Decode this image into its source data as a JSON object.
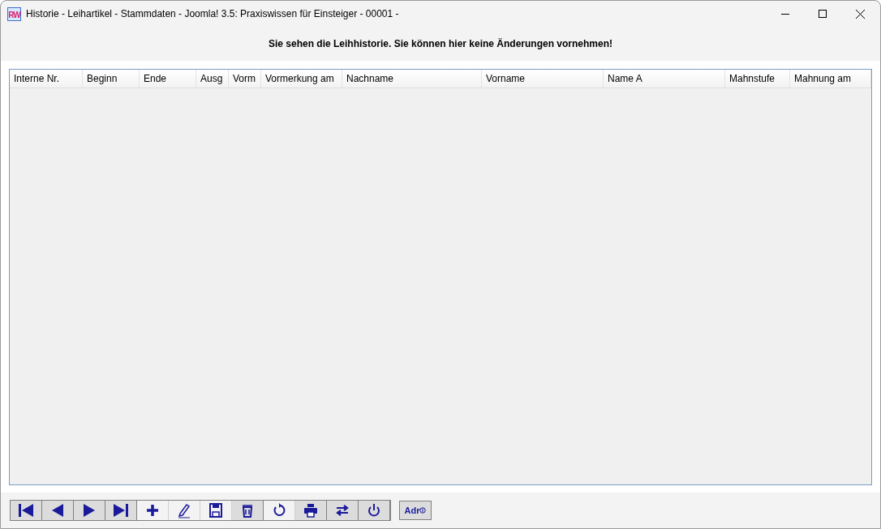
{
  "window": {
    "title": "Historie - Leihartikel - Stammdaten - Joomla! 3.5: Praxiswissen für Einsteiger - 00001 -",
    "app_icon": "RW"
  },
  "notice": "Sie sehen die Leihhistorie. Sie können hier keine Änderungen vornehmen!",
  "table": {
    "columns": [
      "Interne Nr.",
      "Beginn",
      "Ende",
      "Ausg",
      "Vorm",
      "Vormerkung am",
      "Nachname",
      "Vorname",
      "Name A",
      "Mahnstufe",
      "Mahnung am"
    ]
  },
  "toolbar": [
    {
      "kind": "first",
      "disabled": false
    },
    {
      "kind": "prev",
      "disabled": false
    },
    {
      "kind": "next",
      "disabled": false
    },
    {
      "kind": "last",
      "disabled": false
    },
    {
      "kind": "add",
      "disabled": true
    },
    {
      "kind": "edit",
      "disabled": true
    },
    {
      "kind": "save",
      "disabled": true
    },
    {
      "kind": "delete",
      "disabled": false
    },
    {
      "kind": "undo",
      "disabled": true
    },
    {
      "kind": "print",
      "disabled": false
    },
    {
      "kind": "swap",
      "disabled": false
    },
    {
      "kind": "power",
      "disabled": false
    }
  ],
  "address_button": {
    "label": "Adr"
  }
}
